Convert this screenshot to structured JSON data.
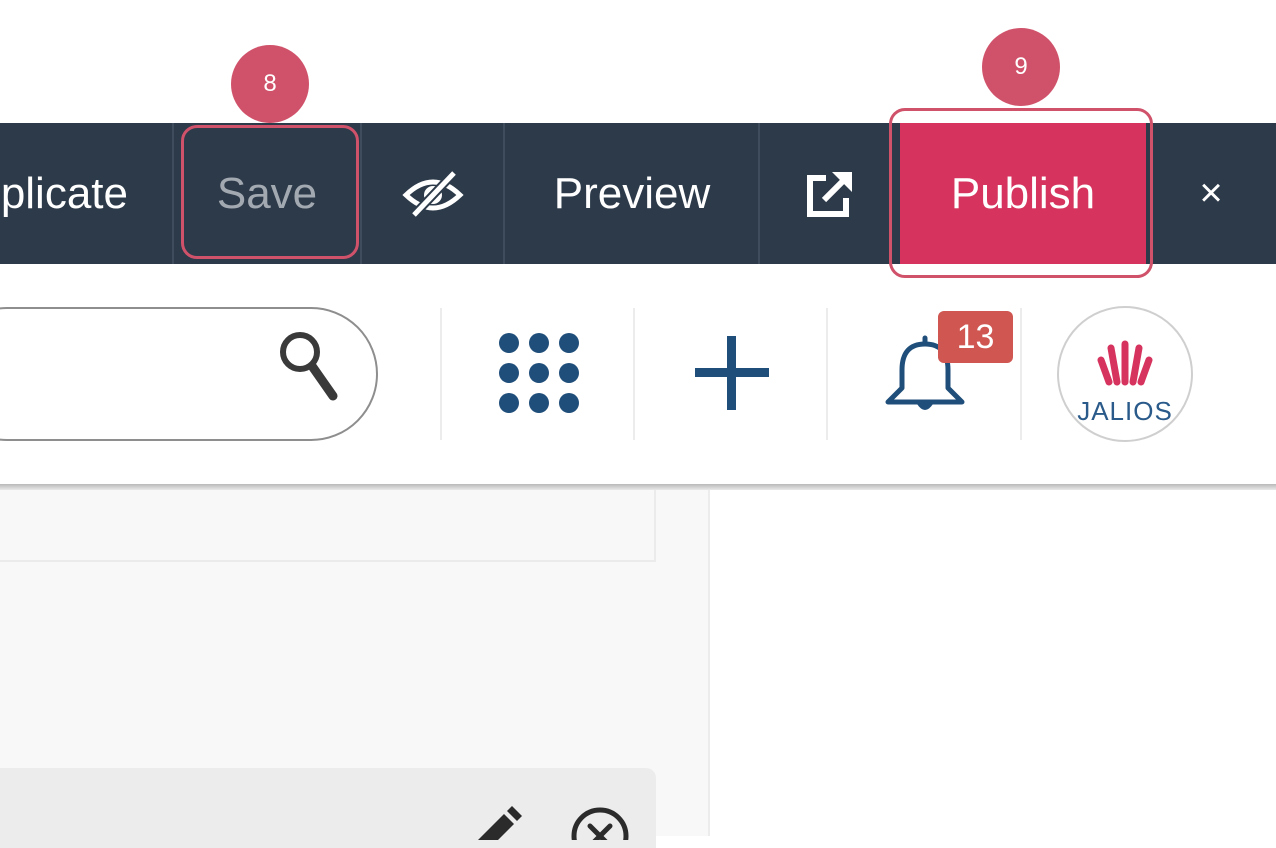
{
  "toolbar": {
    "duplicate_label": "plicate",
    "save_label": "Save",
    "preview_label": "Preview",
    "publish_label": "Publish",
    "close_label": "×",
    "icons": {
      "hide": "eye-slash-icon",
      "external": "external-link-icon"
    }
  },
  "header": {
    "search": {
      "value": "",
      "placeholder": "",
      "icon": "search-icon"
    },
    "apps_icon": "apps-grid-icon",
    "add_icon": "plus-icon",
    "notifications": {
      "icon": "bell-icon",
      "count": "13"
    },
    "avatar": {
      "label": "JALIOS"
    }
  },
  "content": {
    "card_actions": {
      "edit_icon": "pencil-icon",
      "remove_icon": "close-circle-icon"
    }
  },
  "callouts": [
    {
      "number": "8",
      "target": "Save"
    },
    {
      "number": "9",
      "target": "Publish"
    }
  ],
  "colors": {
    "toolbar_bg": "#2d3a4a",
    "publish_bg": "#d6335e",
    "callout": "#d0526a",
    "badge": "#cf5651",
    "icon_blue": "#1f4e7a"
  }
}
